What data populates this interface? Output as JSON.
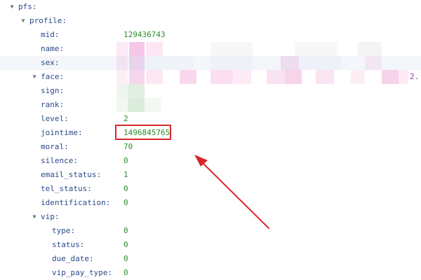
{
  "tree": {
    "root_key": "pfs:",
    "profile_key": "profile:",
    "mid": {
      "key": "mid:",
      "value": "129436743"
    },
    "name": {
      "key": "name:"
    },
    "sex": {
      "key": "sex:"
    },
    "face": {
      "key": "face:",
      "value_tail": "2."
    },
    "sign": {
      "key": "sign:"
    },
    "rank": {
      "key": "rank:"
    },
    "level": {
      "key": "level:",
      "value": "2"
    },
    "jointime": {
      "key": "jointime:",
      "value": "1496845765"
    },
    "moral": {
      "key": "moral:",
      "value": "70"
    },
    "silence": {
      "key": "silence:",
      "value": "0"
    },
    "email_status": {
      "key": "email_status:",
      "value": "1"
    },
    "tel_status": {
      "key": "tel_status:",
      "value": "0"
    },
    "identification": {
      "key": "identification:",
      "value": "0"
    },
    "vip_key": "vip:",
    "vip": {
      "type": {
        "key": "type:",
        "value": "0"
      },
      "status": {
        "key": "status:",
        "value": "0"
      },
      "due_date": {
        "key": "due_date:",
        "value": "0"
      },
      "vip_pay_type": {
        "key": "vip_pay_type:",
        "value": "0"
      }
    }
  },
  "icons": {
    "expanded_toggle": "triangle-down-icon"
  },
  "colors": {
    "key_text": "#2c4a8a",
    "number_value": "#2e8b2e",
    "string_value": "#9b3aa5",
    "annotation": "#d9262c",
    "row_stripe": "#f3f6fa"
  }
}
